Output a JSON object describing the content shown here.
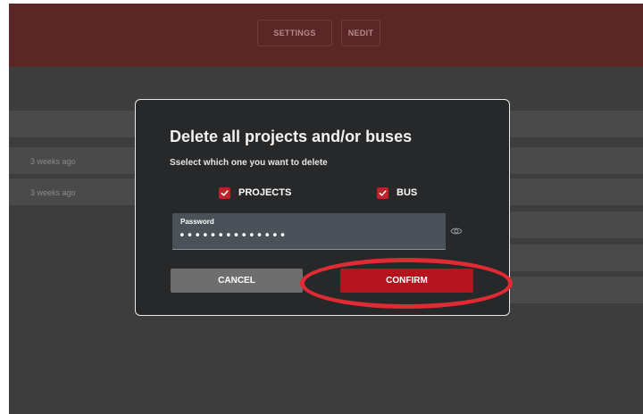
{
  "header": {
    "settings_label": "SETTINGS",
    "nedit_label": "NEDIT"
  },
  "background_list": {
    "rows": [
      {
        "time": ""
      },
      {
        "time": "3 weeks ago"
      },
      {
        "time": "3 weeks ago"
      }
    ]
  },
  "modal": {
    "title": "Delete all projects and/or buses",
    "subtitle": "Sselect which one you want to delete",
    "checkboxes": [
      {
        "label": "PROJECTS",
        "checked": true
      },
      {
        "label": "BUS",
        "checked": true
      }
    ],
    "password": {
      "label": "Password",
      "value": "••••••••••••••"
    },
    "cancel_label": "CANCEL",
    "confirm_label": "CONFIRM"
  },
  "colors": {
    "header": "#5a2626",
    "modal_bg": "#262829",
    "accent": "#b3141d",
    "annotation": "#e02a34"
  },
  "icons": {
    "checkbox": "check-icon",
    "reveal": "eye-icon"
  }
}
